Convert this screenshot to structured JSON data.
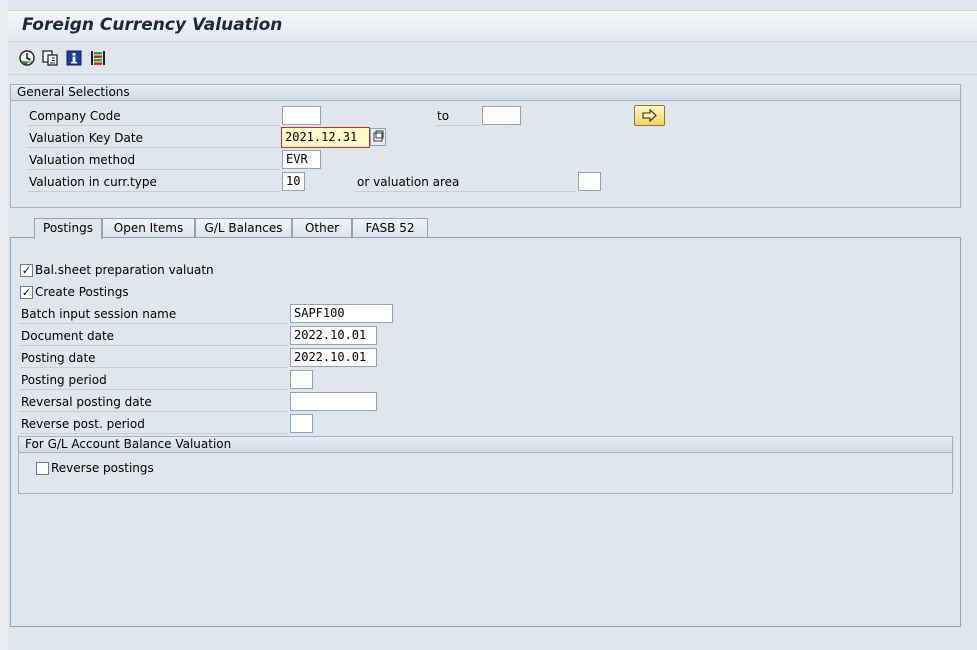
{
  "title": "Foreign Currency Valuation",
  "toolbar": {
    "icons": [
      "execute-icon",
      "copy-variant-icon",
      "info-icon",
      "selection-options-icon"
    ]
  },
  "general": {
    "header": "General Selections",
    "company_code_label": "Company Code",
    "company_code_from": "",
    "to_label": "to",
    "company_code_to": "",
    "key_date_label": "Valuation Key Date",
    "key_date_value": "2021.12.31",
    "method_label": "Valuation method",
    "method_value": "EVR",
    "curr_type_label": "Valuation in curr.type",
    "curr_type_value": "10",
    "val_area_label": "or valuation area",
    "val_area_value": ""
  },
  "tabs": [
    "Postings",
    "Open Items",
    "G/L Balances",
    "Other",
    "FASB 52"
  ],
  "postings": {
    "bal_sheet_label": "Bal.sheet preparation valuatn",
    "bal_sheet_checked": true,
    "create_postings_label": "Create Postings",
    "create_postings_checked": true,
    "batch_label": "Batch input session name",
    "batch_value": "SAPF100",
    "doc_date_label": "Document date",
    "doc_date_value": "2022.10.01",
    "post_date_label": "Posting date",
    "post_date_value": "2022.10.01",
    "post_period_label": "Posting period",
    "post_period_value": "",
    "rev_post_date_label": "Reversal posting date",
    "rev_post_date_value": "",
    "rev_post_period_label": "Reverse post. period",
    "rev_post_period_value": "",
    "gl_group_header": "For G/L Account Balance Valuation",
    "reverse_postings_label": "Reverse postings",
    "reverse_postings_checked": false
  },
  "colors": {
    "background": "#dfe6ed",
    "focus_field": "#fffbc8",
    "multi_select_button": "#f2d65d"
  }
}
